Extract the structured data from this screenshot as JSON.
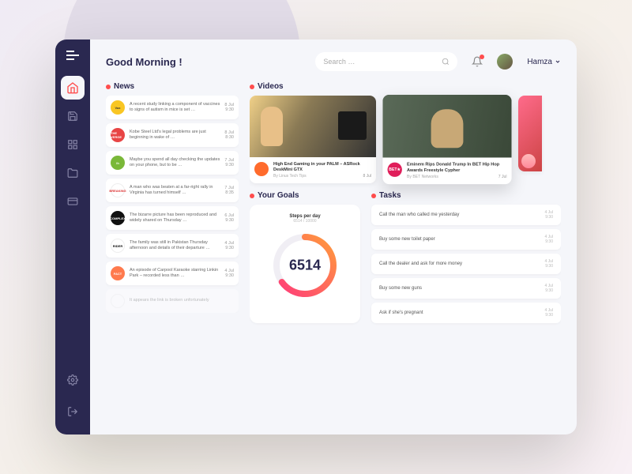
{
  "header": {
    "greeting": "Good Morning !",
    "searchPlaceholder": "Search …",
    "username": "Hamza"
  },
  "sections": {
    "news": "News",
    "videos": "Videos",
    "goals": "Your Goals",
    "tasks": "Tasks"
  },
  "news": [
    {
      "logo": "l-vox",
      "logoText": "Vox",
      "text": "A recent study linking a component of vaccines to signs of autism in mice is set …",
      "date": "8 Jul",
      "time": "9:30"
    },
    {
      "logo": "l-verge",
      "logoText": "THE VERGE",
      "text": "Kobe Steel Ltd's legal problems are just beginning in wake of …",
      "date": "8 Jul",
      "time": "8:30"
    },
    {
      "logo": "l-lh",
      "logoText": "lh",
      "text": "Maybe you spend all day checking the updates on your phone, but to be …",
      "date": "7 Jul",
      "time": "9:30"
    },
    {
      "logo": "l-br",
      "logoText": "BREAKING",
      "text": "A man who was beaten at a far-right rally in Virginia has turned himself …",
      "date": "7 Jul",
      "time": "8:35"
    },
    {
      "logo": "l-cx",
      "logoText": "COMPLEX",
      "text": "The bizarre picture has been reproduced and widely shared on Thursday …",
      "date": "6 Jul",
      "time": "9:30"
    },
    {
      "logo": "l-ri",
      "logoText": "RIDER",
      "text": "The family was still in Pakistan Thursday afternoon and details of their departure …",
      "date": "4 Jul",
      "time": "9:30"
    },
    {
      "logo": "l-fact",
      "logoText": "FACT",
      "text": "An episode of Carpool Karaoke starring Linkin Park – recorded less than …",
      "date": "4 Jul",
      "time": "9:30"
    },
    {
      "logo": "l-br",
      "logoText": "",
      "text": "It appears the link is broken unfortunately",
      "date": "",
      "time": "",
      "faded": true
    }
  ],
  "videos": [
    {
      "thumb": "vt1",
      "logo": "vl1",
      "title": "High End Gaming in your PALM – ASRock DeskMini GTX",
      "author": "By Linus Tech Tips",
      "date": "8 Jul"
    },
    {
      "thumb": "vt2",
      "logo": "vl2",
      "logoText": "BET★",
      "title": "Eminem Rips Donald Trump In BET Hip Hop Awards Freestyle Cypher",
      "author": "By BET Networks",
      "date": "7 Jul"
    }
  ],
  "goal": {
    "label": "Steps per day",
    "sub": "6514 / 10000",
    "value": "6514",
    "percent": 65
  },
  "tasks": [
    {
      "text": "Call the man who called me yesterday",
      "due": "4 Jul",
      "time": "9:30"
    },
    {
      "text": "Buy some new toilet paper",
      "due": "4 Jul",
      "time": "9:30"
    },
    {
      "text": "Call the dealer and ask for more money",
      "due": "4 Jul",
      "time": "9:30"
    },
    {
      "text": "Buy some new guns",
      "due": "4 Jul",
      "time": "9:30"
    },
    {
      "text": "Ask if she's pregnant",
      "due": "4 Jul",
      "time": "9:30"
    }
  ]
}
